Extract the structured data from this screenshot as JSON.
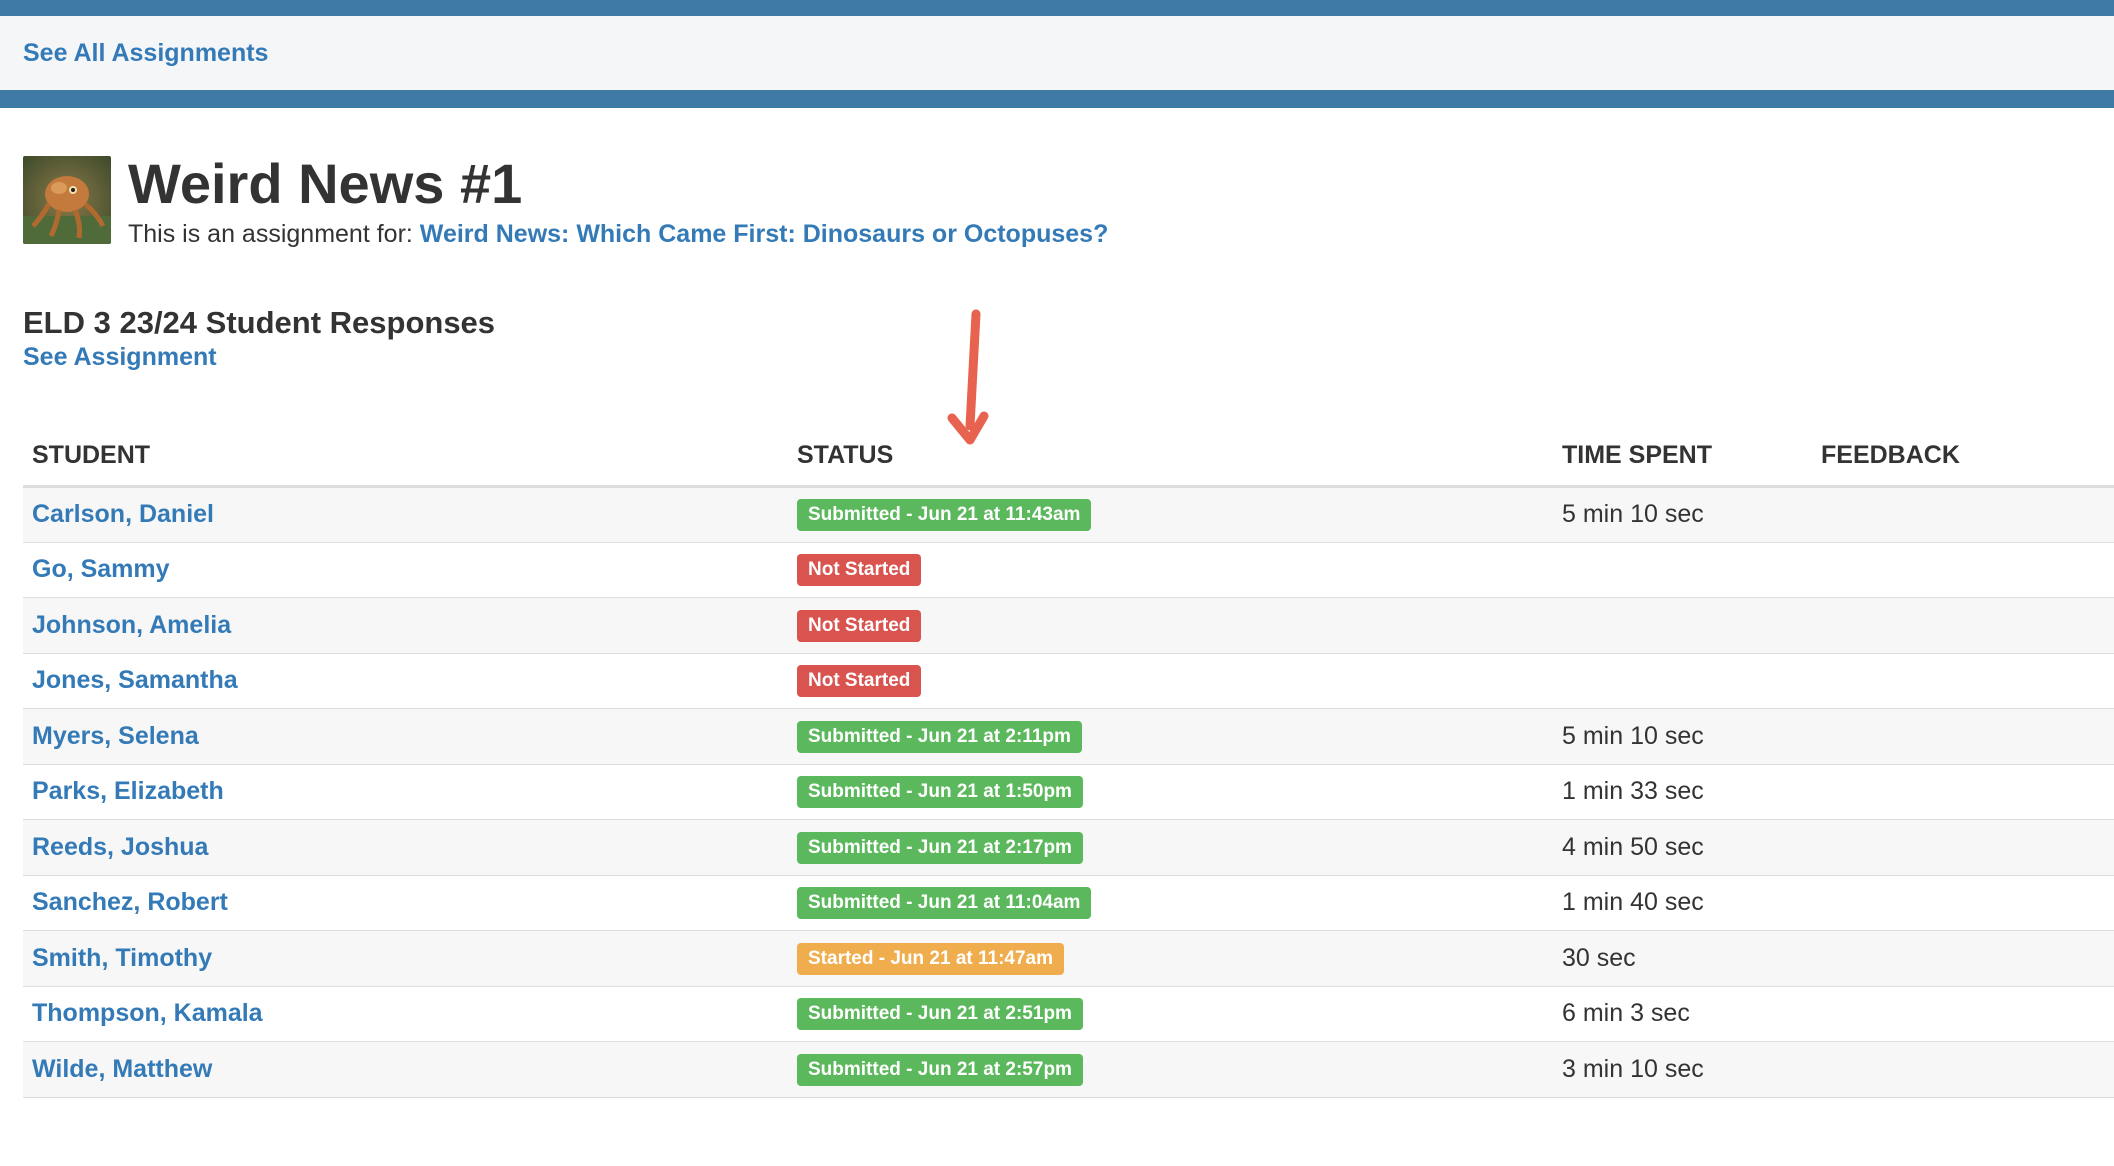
{
  "nav": {
    "back_label": "See All Assignments"
  },
  "header": {
    "title": "Weird News #1",
    "subtitle_prefix": "This is an assignment for:",
    "subtitle_link": "Weird News: Which Came First: Dinosaurs or Octopuses?"
  },
  "section": {
    "title": "ELD 3 23/24 Student Responses",
    "see_assignment": "See Assignment"
  },
  "table": {
    "columns": [
      "STUDENT",
      "STATUS",
      "TIME SPENT",
      "FEEDBACK"
    ],
    "rows": [
      {
        "student": "Carlson, Daniel",
        "status": "Submitted - Jun 21 at 11:43am",
        "status_type": "submitted",
        "time": "5 min 10 sec",
        "feedback": ""
      },
      {
        "student": "Go, Sammy",
        "status": "Not Started",
        "status_type": "not-started",
        "time": "",
        "feedback": ""
      },
      {
        "student": "Johnson, Amelia",
        "status": "Not Started",
        "status_type": "not-started",
        "time": "",
        "feedback": ""
      },
      {
        "student": "Jones, Samantha",
        "status": "Not Started",
        "status_type": "not-started",
        "time": "",
        "feedback": ""
      },
      {
        "student": "Myers, Selena",
        "status": "Submitted - Jun 21 at 2:11pm",
        "status_type": "submitted",
        "time": "5 min 10 sec",
        "feedback": ""
      },
      {
        "student": "Parks, Elizabeth",
        "status": "Submitted - Jun 21 at 1:50pm",
        "status_type": "submitted",
        "time": "1 min 33 sec",
        "feedback": ""
      },
      {
        "student": "Reeds, Joshua",
        "status": "Submitted - Jun 21 at 2:17pm",
        "status_type": "submitted",
        "time": "4 min 50 sec",
        "feedback": ""
      },
      {
        "student": "Sanchez, Robert",
        "status": "Submitted - Jun 21 at 11:04am",
        "status_type": "submitted",
        "time": "1 min 40 sec",
        "feedback": ""
      },
      {
        "student": "Smith, Timothy",
        "status": "Started - Jun 21 at 11:47am",
        "status_type": "started",
        "time": "30 sec",
        "feedback": ""
      },
      {
        "student": "Thompson, Kamala",
        "status": "Submitted - Jun 21 at 2:51pm",
        "status_type": "submitted",
        "time": "6 min 3 sec",
        "feedback": ""
      },
      {
        "student": "Wilde, Matthew",
        "status": "Submitted - Jun 21 at 2:57pm",
        "status_type": "submitted",
        "time": "3 min 10 sec",
        "feedback": ""
      }
    ]
  },
  "colors": {
    "stripe": "#3e7aa3",
    "link": "#337ab7",
    "submitted": "#5cb85c",
    "not_started": "#d9534f",
    "started": "#f0ad4e",
    "annotation_arrow": "#e8634f"
  },
  "icons": {
    "assignment_thumbnail": "octopus-thumbnail-icon",
    "annotation": "down-arrow-annotation-icon"
  }
}
